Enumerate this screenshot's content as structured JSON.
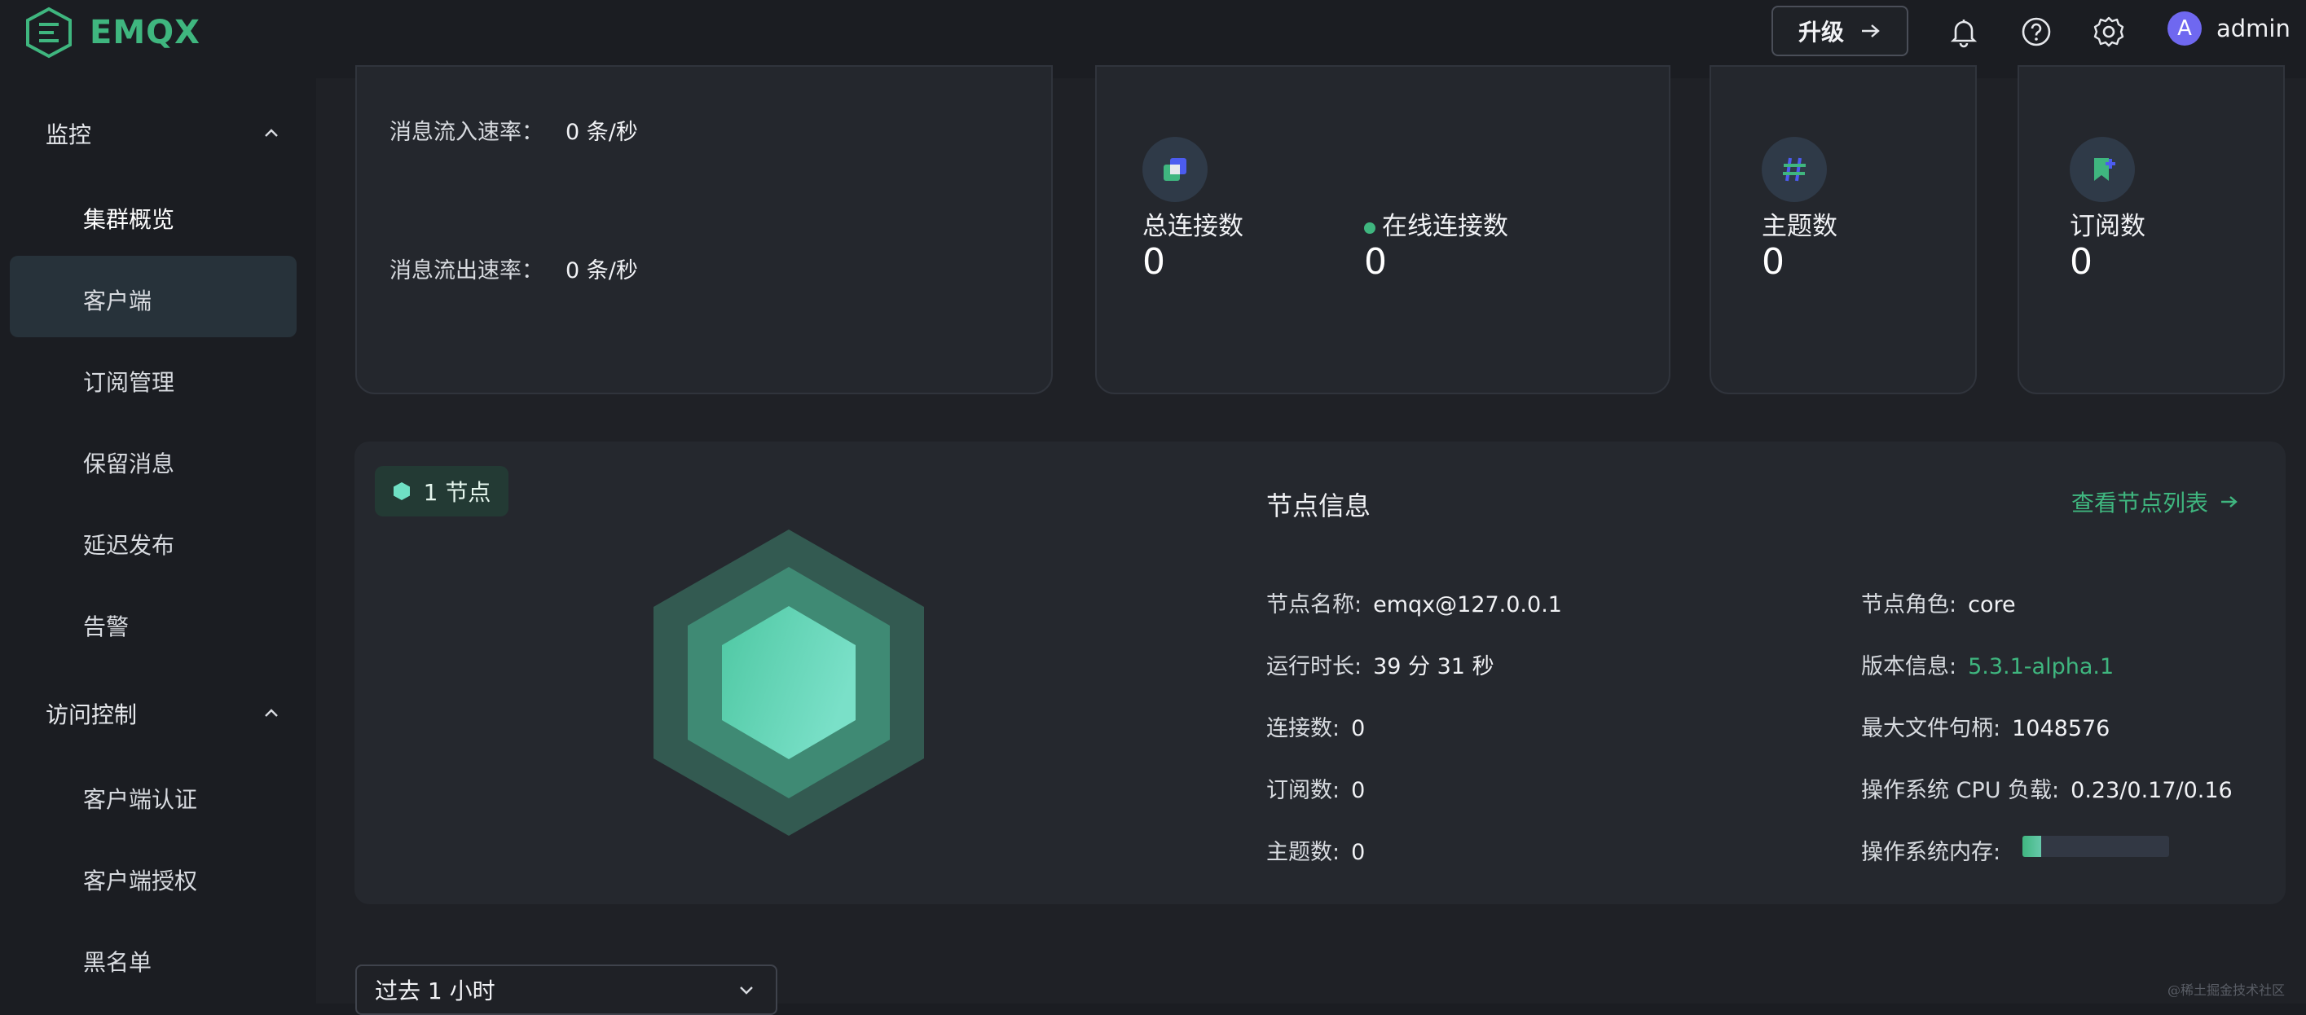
{
  "brand": {
    "name": "EMQX"
  },
  "header": {
    "upgrade_label": "升级",
    "username": "admin",
    "avatar_initial": "A"
  },
  "sidebar": {
    "groups": [
      {
        "label": "监控",
        "items": [
          {
            "label": "集群概览",
            "active": true
          },
          {
            "label": "客户端"
          },
          {
            "label": "订阅管理"
          },
          {
            "label": "保留消息"
          },
          {
            "label": "延迟发布"
          },
          {
            "label": "告警"
          }
        ]
      },
      {
        "label": "访问控制",
        "items": [
          {
            "label": "客户端认证"
          },
          {
            "label": "客户端授权"
          },
          {
            "label": "黑名单"
          }
        ]
      }
    ]
  },
  "rates": {
    "in_label": "消息流入速率：",
    "in_value": "0 条/秒",
    "out_label": "消息流出速率：",
    "out_value": "0 条/秒"
  },
  "stats": {
    "total_connections_label": "总连接数",
    "total_connections": "0",
    "online_connections_label": "在线连接数",
    "online_connections": "0",
    "topics_label": "主题数",
    "topics": "0",
    "subscriptions_label": "订阅数",
    "subscriptions": "0"
  },
  "nodes": {
    "badge": "1 节点",
    "info_title": "节点信息",
    "view_list": "查看节点列表",
    "left": [
      {
        "label": "节点名称:",
        "value": "emqx@127.0.0.1"
      },
      {
        "label": "运行时长:",
        "value": "39 分 31 秒"
      },
      {
        "label": "连接数:",
        "value": "0"
      },
      {
        "label": "订阅数:",
        "value": "0"
      },
      {
        "label": "主题数:",
        "value": "0"
      }
    ],
    "right": [
      {
        "label": "节点角色:",
        "value": "core"
      },
      {
        "label": "版本信息:",
        "value": "5.3.1-alpha.1"
      },
      {
        "label": "最大文件句柄:",
        "value": "1048576"
      },
      {
        "label": "操作系统 CPU 负载:",
        "value": "0.23/0.17/0.16"
      },
      {
        "label": "操作系统内存:",
        "value": ""
      }
    ],
    "memory_usage_fraction": 0.13
  },
  "time_range": {
    "selected": "过去 1 小时"
  },
  "watermark": "@稀土掘金技术社区",
  "colors": {
    "accent": "#3fb67f",
    "sidebar_active": "#27323a",
    "card_bg": "#24272d"
  }
}
